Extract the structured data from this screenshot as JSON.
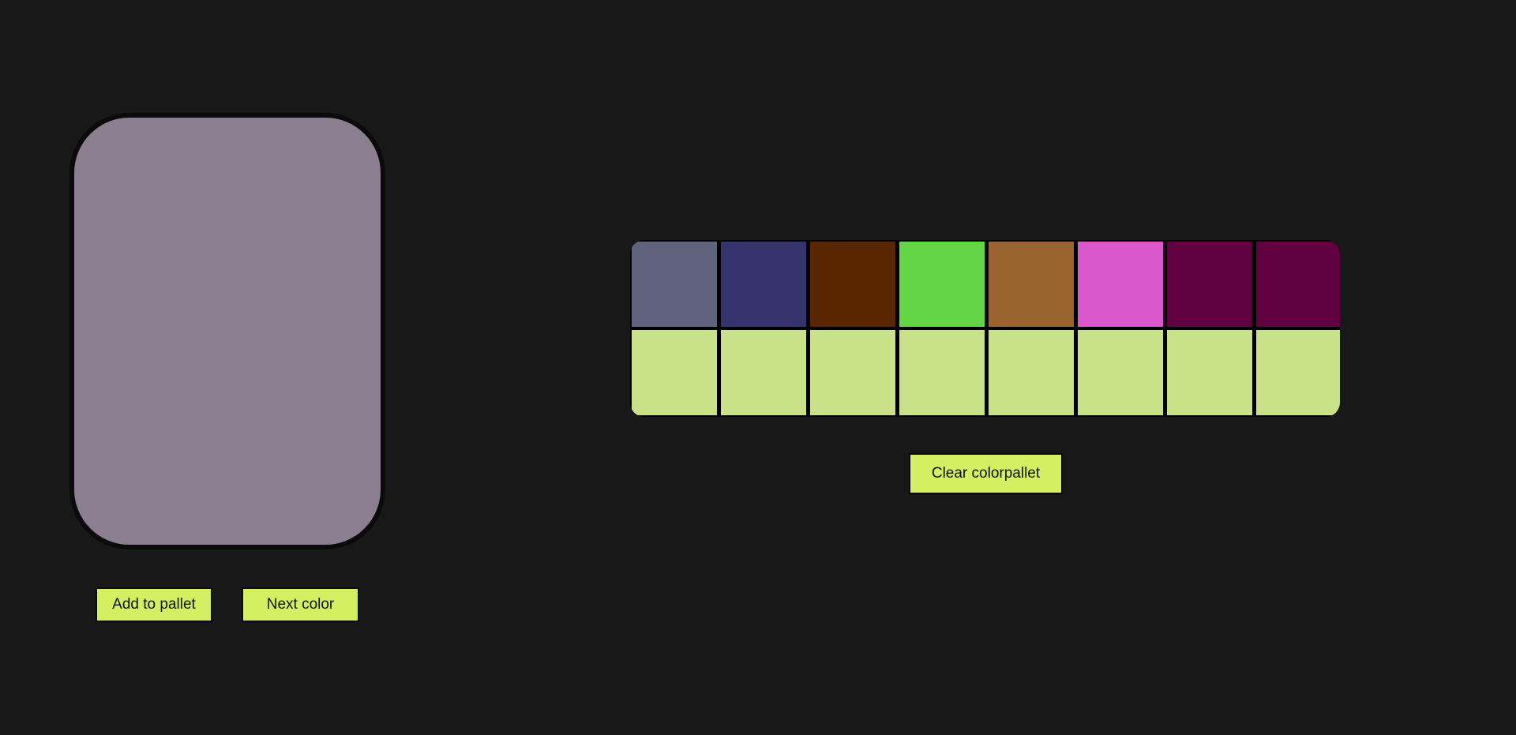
{
  "preview": {
    "current_color": "#8b7f8f"
  },
  "buttons": {
    "add_label": "Add to pallet",
    "next_label": "Next color",
    "clear_label": "Clear colorpallet",
    "color": "#d4ef62"
  },
  "palette": {
    "swatches": [
      "#5f637d",
      "#36346e",
      "#5a2600",
      "#63d647",
      "#9a6430",
      "#db58cc",
      "#600040",
      "#600040",
      "#c9e189",
      "#c9e189",
      "#c9e189",
      "#c9e189",
      "#c9e189",
      "#c9e189",
      "#c9e189",
      "#c9e189"
    ]
  }
}
